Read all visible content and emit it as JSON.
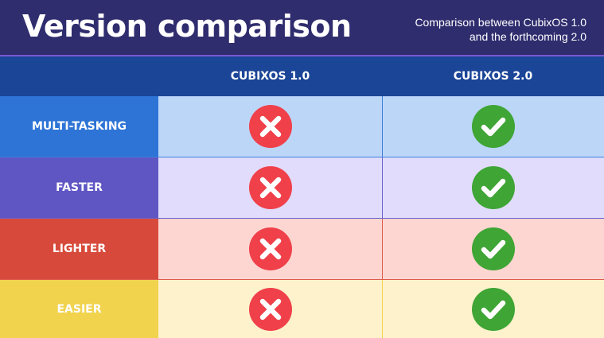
{
  "header": {
    "title": "Version comparison",
    "subtitle_line1": "Comparison between CubixOS 1.0",
    "subtitle_line2": "and the forthcoming 2.0"
  },
  "columns": [
    "CUBIXOS 1.0",
    "CUBIXOS 2.0"
  ],
  "rows": [
    {
      "label": "MULTI-TASKING",
      "v1": "no",
      "v2": "yes",
      "label_color": "#2e74d6",
      "cell_color": "#bcd6f8",
      "border_color": "#3f7fd9"
    },
    {
      "label": "FASTER",
      "v1": "no",
      "v2": "yes",
      "label_color": "#5f56c4",
      "cell_color": "#e1dcfb",
      "border_color": "#6b62c9"
    },
    {
      "label": "LIGHTER",
      "v1": "no",
      "v2": "yes",
      "label_color": "#d74a3b",
      "cell_color": "#fdd6d2",
      "border_color": "#de5b4d"
    },
    {
      "label": "EASIER",
      "v1": "no",
      "v2": "yes",
      "label_color": "#f1d34e",
      "cell_color": "#fdf2cc",
      "border_color": "#f1d34e"
    }
  ],
  "icons": {
    "no": "x-circle-icon",
    "yes": "check-circle-icon"
  },
  "colors": {
    "header_bg": "#2f2d6e",
    "column_header_bg": "#1b4597",
    "no_color": "#f0404a",
    "yes_color": "#3fa535"
  }
}
